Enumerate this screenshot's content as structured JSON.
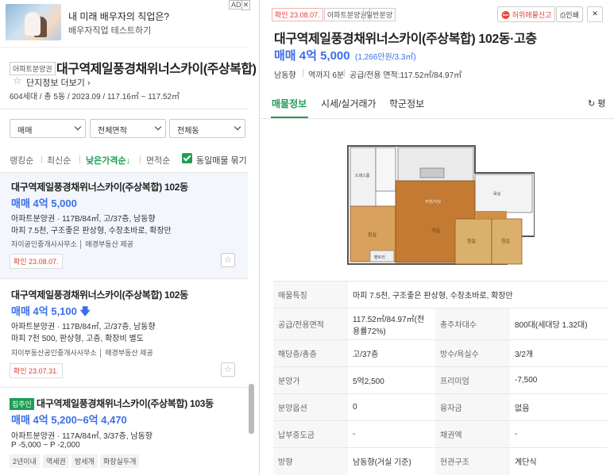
{
  "ad": {
    "title": "내 미래 배우자의 직업은?",
    "subtitle": "배우자직업 테스트하기",
    "badge": "AD",
    "close": "✕"
  },
  "complex": {
    "badge": "아파트분양권",
    "name": "대구역제일풍경채위너스카이(주상복합)",
    "complex_info": "단지정보 더보기 ›",
    "meta": "604세대 / 총 5동 / 2023.09 / 117.16㎡ ~ 117.52㎡"
  },
  "filters": {
    "trade": "매매",
    "area": "전체면적",
    "dong": "전체동"
  },
  "sort": {
    "ranking": "랭킹순",
    "latest": "최신순",
    "low_price": "낮은가격순↓",
    "area": "면적순",
    "same_listing": "동일매물 묶기"
  },
  "listings": [
    {
      "name": "대구역제일풍경채위너스카이(주상복합) 102동",
      "price": "매매 4억 5,000",
      "line1": "아파트분양권 · 117B/84㎡, 고/37층, 남동향",
      "line2": "마피 7.5천, 구조좋은 판상형, 수창초바로, 확장만",
      "agent": "자이공인중개사사무소 │ 매경부동산 제공",
      "confirmed": "확인 23.08.07."
    },
    {
      "name": "대구역제일풍경채위너스카이(주상복합) 102동",
      "price": "매매 4억 5,100",
      "line1": "아파트분양권 · 117B/84㎡, 고/37층, 남동향",
      "line2": "마피 7천 500, 판상형, 고층, 확장비 별도",
      "agent": "자이부동산공인중개사사무소 │ 매경부동산 제공",
      "confirmed": "확인 23.07.31."
    },
    {
      "badge": "집주인",
      "name": "대구역제일풍경채위너스카이(주상복합) 103동",
      "price": "매매 4억 5,200~6억 4,470",
      "line1": "아파트분양권 · 117A/84㎡, 3/37층, 남동향",
      "line2": "P -5,000 ~ P -2,000",
      "tags": [
        "2년이내",
        "역세권",
        "방세개",
        "화장실두개"
      ]
    }
  ],
  "detail": {
    "confirmed": "확인 23.08.07.",
    "type_tag": "아파트분양권",
    "sale_tag": "일반분양",
    "report": "허위매물신고",
    "print": "인쇄",
    "close": "✕",
    "title": "대구역제일풍경채위너스카이(주상복합) 102동·고층",
    "price": "매매 4억 5,000",
    "price_per": "(1,266만원/3.3㎡)",
    "direction": "남동향",
    "distance": "역까지 6분",
    "area": "공급/전용 면적:117.52㎡/84.97㎡",
    "tabs": [
      "매물정보",
      "시세/실거래가",
      "학군정보"
    ],
    "refresh": "평",
    "rows": [
      {
        "h1": "매물특징",
        "v1": "마피 7.5천, 구조좋은 판상형, 수창초바로, 확장만"
      },
      {
        "h1": "공급/전용면적",
        "v1": "117.52㎡/84.97㎡(전용률72%)",
        "h2": "총주차대수",
        "v2": "800대(세대당 1.32대)"
      },
      {
        "h1": "해당층/총층",
        "v1": "고/37층",
        "h2": "방수/욕실수",
        "v2": "3/2개"
      },
      {
        "h1": "분양가",
        "v1": "5억2,500",
        "h2": "프리미엄",
        "v2": "-7,500"
      },
      {
        "h1": "분양옵션",
        "v1": "0",
        "h2": "융자금",
        "v2": "없음"
      },
      {
        "h1": "납부중도금",
        "v1": "-",
        "h2": "채권액",
        "v2": "-"
      },
      {
        "h1": "방향",
        "v1": "남동향(거실 기준)",
        "h2": "현관구조",
        "v2": "계단식"
      }
    ],
    "floorplan_labels": {
      "living": "거실",
      "room1": "침실",
      "room2": "침실",
      "room3": "침실",
      "kitchen": "주방/식당",
      "dress": "드레스룸",
      "bath": "욕실",
      "storage": "팬트리"
    }
  }
}
